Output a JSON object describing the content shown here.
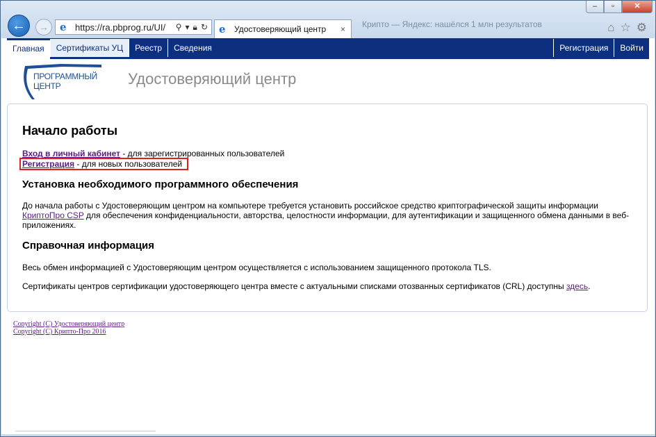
{
  "browser": {
    "url": "https://ra.pbprog.ru/UI/",
    "tab_title": "Удостоверяющий центр",
    "ghost_tab": "Крипто — Яндекс: нашёлся 1 млн результатов",
    "close_tab": "×"
  },
  "nav": {
    "left": [
      "Главная",
      "Сертификаты УЦ",
      "Реестр",
      "Сведения"
    ],
    "right": [
      "Регистрация",
      "Войти"
    ]
  },
  "header": {
    "logo_line1": "ПРОГРАММНЫЙ",
    "logo_line2": "ЦЕНТР",
    "site_title": "Удостоверяющий центр"
  },
  "main": {
    "heading": "Начало работы",
    "login_link": "Вход в личный кабинет",
    "login_desc": " - для зарегистрированных пользователей",
    "register_link": "Регистрация",
    "register_desc": " - для новых пользователей",
    "software_heading": "Установка необходимого программного обеспечения",
    "software_text1": "До начала работы с Удостоверяющим центром на компьютере требуется установить российское средство криптографической защиты информации",
    "software_link": "КриптоПро CSP",
    "software_text2": " для обеспечения конфиденциальности, авторства, целостности информации, для аутентификации и защищенного обмена данными в веб-приложениях.",
    "info_heading": "Справочная информация",
    "info_text1": "Весь обмен информацией с Удостоверяющим центром осуществляется с использованием защищенного протокола TLS.",
    "info_text2": "Сертификаты центров сертификации удостоверяющего центра вместе с актуальными списками отозванных сертификатов (CRL) доступны ",
    "info_link": "здесь",
    "info_end": "."
  },
  "footer": {
    "copyright1": "Copyright (C) Удостоверяющий центр",
    "copyright2": "Copyright (C) Крипто-Про 2016"
  },
  "colors": {
    "nav_bg": "#0c2f80",
    "link": "#5a1a86",
    "highlight": "#e01e1e"
  }
}
